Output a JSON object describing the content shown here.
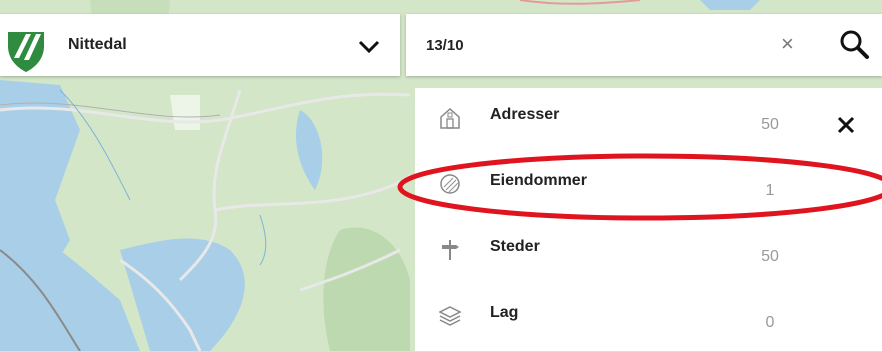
{
  "municipality": {
    "name": "Nittedal"
  },
  "search": {
    "value": "13/10",
    "clear_symbol": "×"
  },
  "results": {
    "close_symbol": "✕",
    "categories": [
      {
        "label": "Adresser",
        "count": "50",
        "icon": "house-icon"
      },
      {
        "label": "Eiendommer",
        "count": "1",
        "icon": "property-icon"
      },
      {
        "label": "Steder",
        "count": "50",
        "icon": "signpost-icon"
      },
      {
        "label": "Lag",
        "count": "0",
        "icon": "layers-icon"
      }
    ]
  },
  "colors": {
    "map_land": "#d3e6c8",
    "map_water": "#a9cfe8",
    "logo_green": "#2e8b3f",
    "highlight_red": "#e0141e"
  }
}
